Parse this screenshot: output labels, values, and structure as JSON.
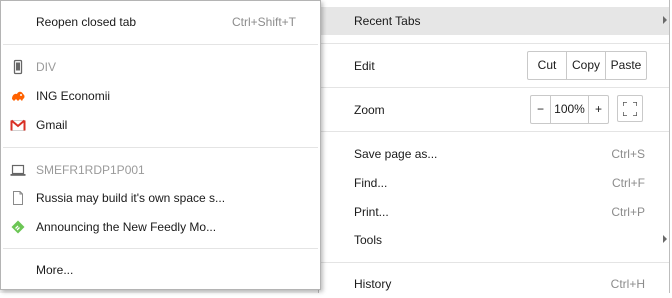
{
  "main_menu": {
    "recent_tabs": "Recent Tabs",
    "edit": {
      "label": "Edit",
      "cut": "Cut",
      "copy": "Copy",
      "paste": "Paste"
    },
    "zoom": {
      "label": "Zoom",
      "minus": "−",
      "value": "100%",
      "plus": "+"
    },
    "save_page": {
      "label": "Save page as...",
      "shortcut": "Ctrl+S"
    },
    "find": {
      "label": "Find...",
      "shortcut": "Ctrl+F"
    },
    "print": {
      "label": "Print...",
      "shortcut": "Ctrl+P"
    },
    "tools": "Tools",
    "history": {
      "label": "History",
      "shortcut": "Ctrl+H"
    }
  },
  "submenu": {
    "reopen": {
      "label": "Reopen closed tab",
      "shortcut": "Ctrl+Shift+T"
    },
    "device1": {
      "name": "DIV",
      "icon": "phone-icon"
    },
    "device1_tabs": [
      {
        "label": "ING Economii",
        "icon": "ing-lion-icon"
      },
      {
        "label": "Gmail",
        "icon": "gmail-icon"
      }
    ],
    "device2": {
      "name": "SMEFR1RDP1P001",
      "icon": "laptop-icon"
    },
    "device2_tabs": [
      {
        "label": "Russia may build it's own space s...",
        "icon": "page-icon"
      },
      {
        "label": "Announcing the New Feedly Mo...",
        "icon": "feedly-icon"
      }
    ],
    "more": "More..."
  },
  "colors": {
    "highlight": "#e6e6e6",
    "ing_orange": "#ff6200",
    "gmail_red": "#d93025",
    "feedly_green": "#6cc655"
  }
}
